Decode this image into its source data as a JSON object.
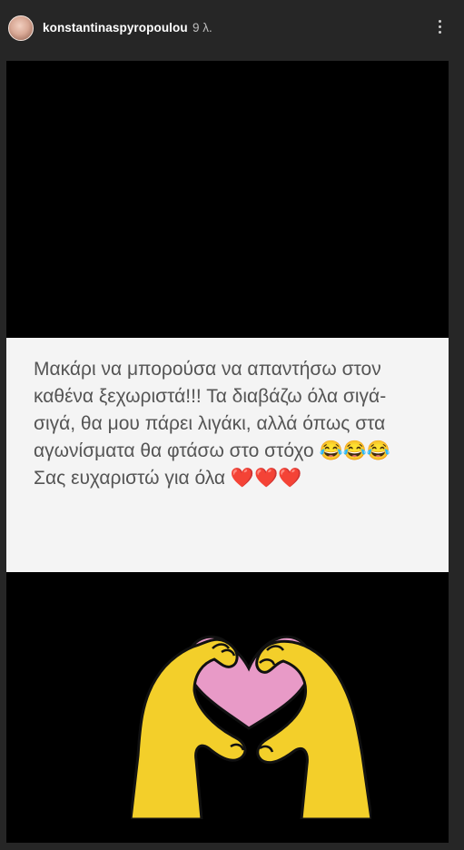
{
  "header": {
    "username": "konstantinaspyropoulou",
    "time": "9 λ.",
    "avatar_icon": "profile-avatar",
    "more_icon": "vertical-ellipsis-icon"
  },
  "story": {
    "message": "Μακάρι να μπορούσα να απαντήσω στον\nκαθένα ξεχωριστά!!! Τα διαβάζω όλα σιγά-\nσιγά, θα μου πάρει λιγάκι, αλλά όπως στα\nαγωνίσματα θα φτάσω στο στόχο 😂😂😂\nΣας ευχαριστώ για όλα ❤️❤️❤️",
    "sticker": "heart-hands-sticker",
    "colors": {
      "background": "#000000",
      "card": "#f4f4f4",
      "text": "#555555",
      "hands": "#f3cf2a",
      "heart": "#e89ac7"
    }
  }
}
